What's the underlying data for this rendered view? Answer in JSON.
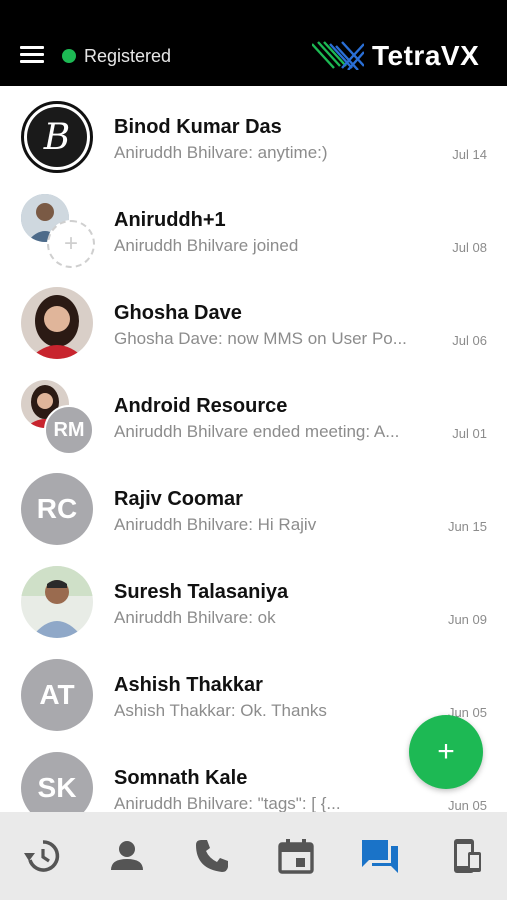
{
  "header": {
    "status": "Registered",
    "brand": "TetraVX"
  },
  "conversations": [
    {
      "name": "Binod Kumar Das",
      "preview": "Aniruddh Bhilvare: anytime:)",
      "date": "Jul 14"
    },
    {
      "name": "Aniruddh+1",
      "preview": "Aniruddh Bhilvare joined",
      "date": "Jul 08"
    },
    {
      "name": "Ghosha Dave",
      "preview": "Ghosha Dave: now MMS on User Po...",
      "date": "Jul 06"
    },
    {
      "name": "Android Resource",
      "preview": "Aniruddh Bhilvare ended meeting: A...",
      "date": "Jul 01",
      "badge": "RM"
    },
    {
      "name": "Rajiv Coomar",
      "preview": "Aniruddh Bhilvare: Hi Rajiv",
      "date": "Jun 15",
      "initials": "RC"
    },
    {
      "name": "Suresh Talasaniya",
      "preview": "Aniruddh Bhilvare: ok",
      "date": "Jun 09"
    },
    {
      "name": "Ashish Thakkar",
      "preview": "Ashish Thakkar: Ok. Thanks",
      "date": "Jun 05",
      "initials": "AT"
    },
    {
      "name": "Somnath Kale",
      "preview": "Aniruddh Bhilvare: \"tags\": [      {...",
      "date": "Jun 05",
      "initials": "SK"
    }
  ],
  "fab": {
    "label": "+"
  },
  "tabs": [
    "history-icon",
    "contacts-icon",
    "phone-icon",
    "calendar-icon",
    "chat-icon",
    "device-transfer-icon"
  ],
  "colors": {
    "accent": "#1db954",
    "active_tab": "#1a73c8",
    "inactive_tab": "#555555"
  }
}
